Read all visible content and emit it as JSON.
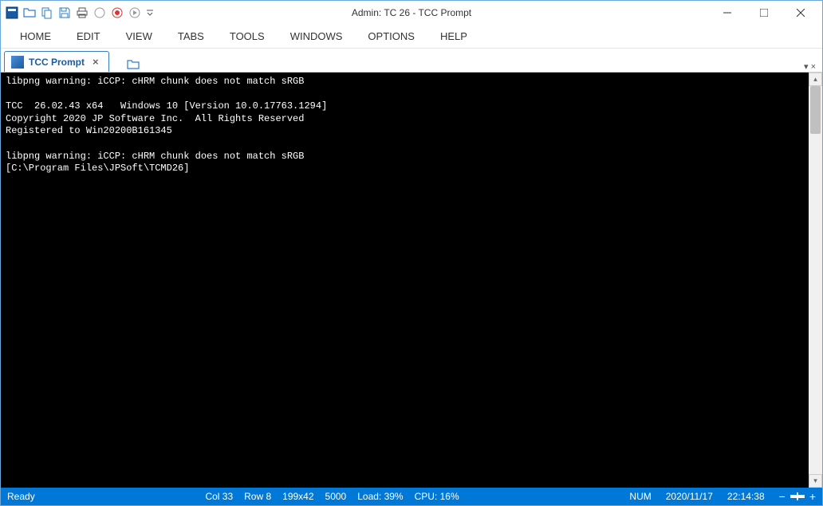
{
  "title": "Admin: TC 26 - TCC Prompt",
  "menu": {
    "home": "HOME",
    "edit": "EDIT",
    "view": "VIEW",
    "tabs": "TABS",
    "tools": "TOOLS",
    "windows": "WINDOWS",
    "options": "OPTIONS",
    "help": "HELP"
  },
  "tabs": {
    "active": "TCC Prompt"
  },
  "terminal": {
    "line1": "libpng warning: iCCP: cHRM chunk does not match sRGB",
    "line2": "",
    "line3": "TCC  26.02.43 x64   Windows 10 [Version 10.0.17763.1294]",
    "line4": "Copyright 2020 JP Software Inc.  All Rights Reserved",
    "line5": "Registered to Win20200B161345",
    "line6": "",
    "line7": "libpng warning: iCCP: cHRM chunk does not match sRGB",
    "line8": "[C:\\Program Files\\JPSoft\\TCMD26]"
  },
  "status": {
    "ready": "Ready",
    "col": "Col 33",
    "row": "Row 8",
    "dims": "199x42",
    "buffer": "5000",
    "load": "Load: 39%",
    "cpu": "CPU: 16%",
    "num": "NUM",
    "date": "2020/11/17",
    "time": "22:14:38"
  }
}
